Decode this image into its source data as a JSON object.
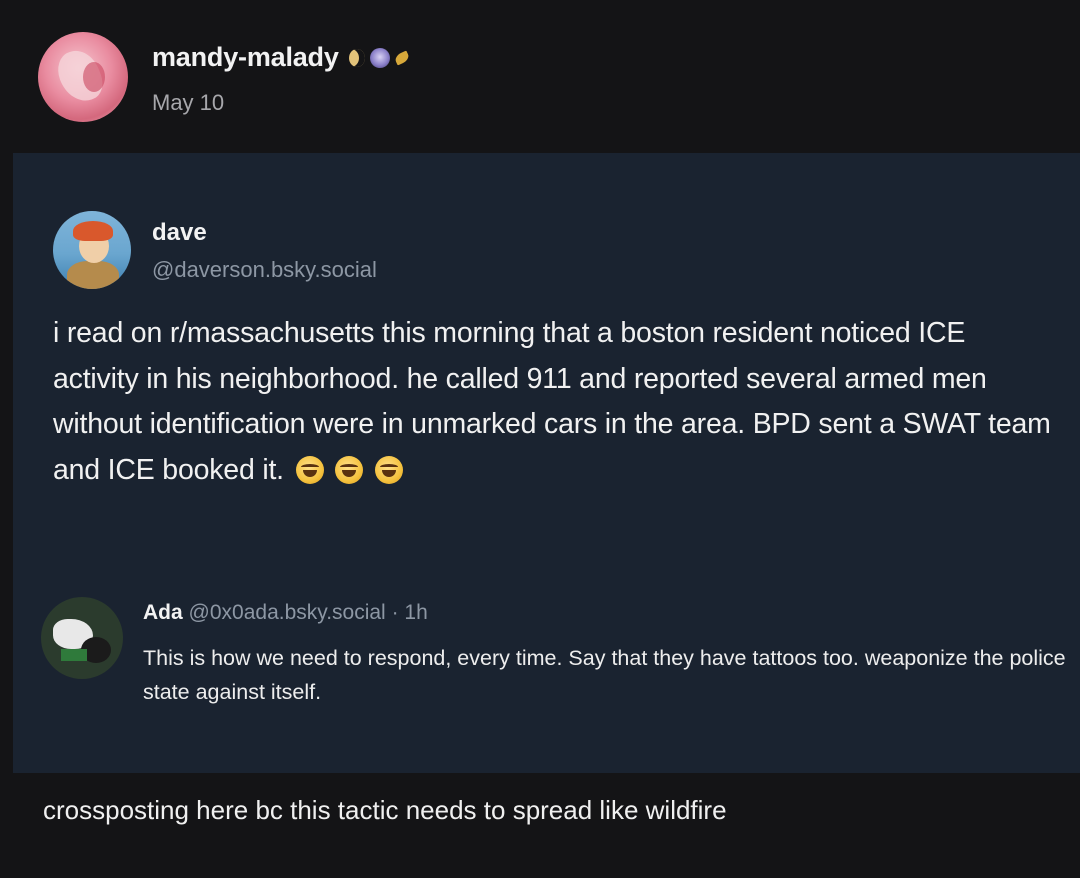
{
  "post": {
    "author": "mandy-malady",
    "badges": [
      "moon-badge",
      "orb-badge",
      "leaf-badge"
    ],
    "date": "May 10",
    "caption": "crossposting here bc this tactic needs to spread like wildfire"
  },
  "embed": {
    "author_name": "dave",
    "author_handle": "@daverson.bsky.social",
    "text": "i read on r/massachusetts this morning that a boston resident noticed ICE activity in his neighborhood. he called 911 and reported several armed men without identification were in unmarked cars in the area. BPD sent a SWAT team and ICE booked it.",
    "emoji": [
      "rolling-on-floor-laughing",
      "rolling-on-floor-laughing",
      "rolling-on-floor-laughing"
    ],
    "reply": {
      "name": "Ada",
      "handle": "@0x0ada.bsky.social",
      "separator": "·",
      "time": "1h",
      "text": "This is how we need to respond, every time. Say that they have tattoos too. weaponize the police state against itself."
    }
  },
  "colors": {
    "page_background": "#141416",
    "embed_background": "#1a2330",
    "handle_text": "#8d97a4"
  }
}
